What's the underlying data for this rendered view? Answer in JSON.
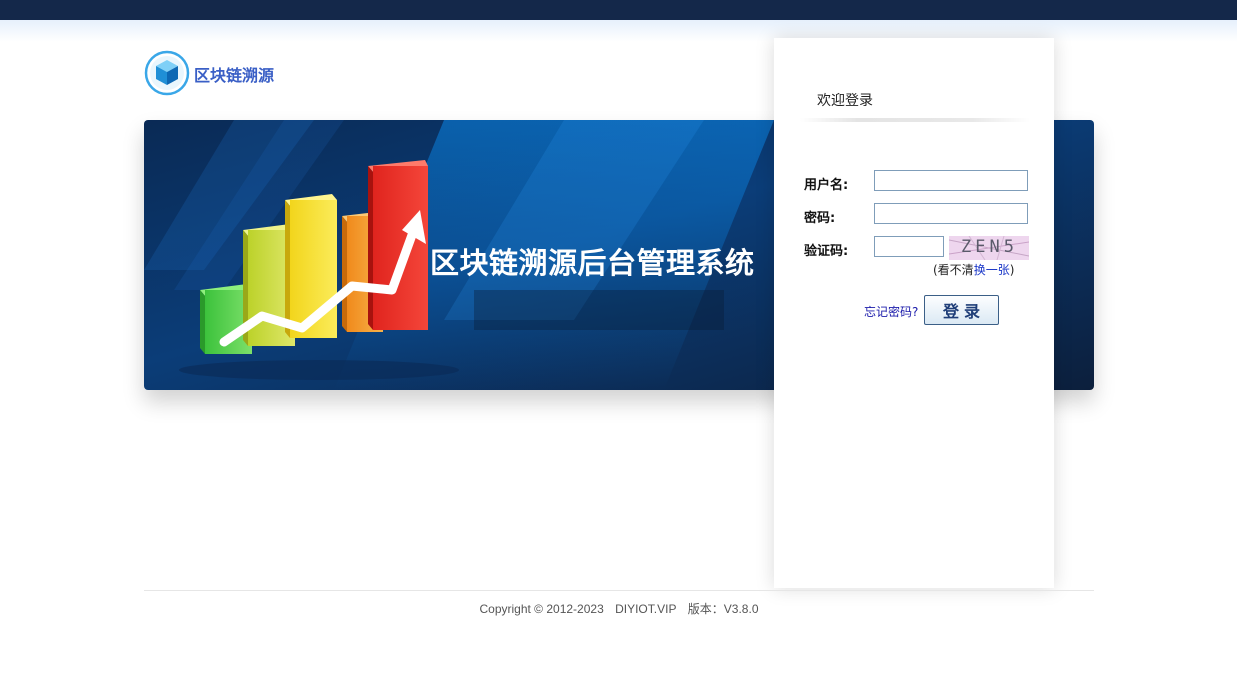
{
  "header": {
    "logo_text": "区块链溯源"
  },
  "banner": {
    "title": "区块链溯源后台管理系统"
  },
  "login": {
    "welcome": "欢迎登录",
    "username_label": "用户名:",
    "password_label": "密码:",
    "captcha_label": "验证码:",
    "username_value": "",
    "password_value": "",
    "captcha_value": "",
    "captcha_image_text": "ZEN5",
    "captcha_hint_prefix": "(看不清",
    "captcha_refresh_link": "换一张",
    "captcha_hint_suffix": ")",
    "forgot_link": "忘记密码?",
    "submit_label": "登录"
  },
  "footer": {
    "copyright": "Copyright © 2012-2023",
    "site": "DIYIOT.VIP",
    "version": "版本：V3.8.0"
  },
  "colors": {
    "top_bar": "#14284a",
    "logo_text": "#3a5fc6",
    "banner_dark": "#0b1f3e",
    "banner_light": "#0a84e6",
    "input_border": "#7f9db9",
    "link": "#1a37c8",
    "button_border": "#3b5f87"
  },
  "icons": {
    "logo": "blue-cube-logo-icon",
    "banner_graphic": "growth-bar-chart-with-arrow-illustration"
  }
}
